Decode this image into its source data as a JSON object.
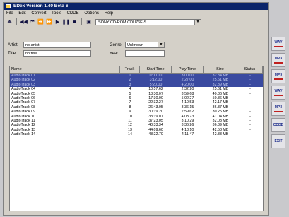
{
  "window": {
    "title": "EDex Version 1.40 Beta 6"
  },
  "menu": [
    "File",
    "Edit",
    "Convert",
    "Tools",
    "CDDB",
    "Options",
    "Help"
  ],
  "toolbar": {
    "drive": "SONY   CD-ROM CDU76E-S"
  },
  "fields": {
    "artist_label": "Artist",
    "artist_value": "no artist",
    "title_label": "Title",
    "title_value": "no title",
    "genre_label": "Genre",
    "genre_value": "Unknown",
    "year_label": "Year",
    "year_value": ""
  },
  "table": {
    "columns": [
      "Name",
      "Track",
      "Start Time",
      "Play Time",
      "Size",
      "Status"
    ],
    "rows": [
      [
        "AudioTrack 01",
        "1",
        "0:00.00",
        "3:00.00",
        "32.34 MB",
        "-"
      ],
      [
        "AudioTrack 02",
        "2",
        "3:12.00",
        "2:27.00",
        "25.61 MB",
        "-"
      ],
      [
        "AudioTrack 03",
        "3",
        "5:20.00",
        "4:20.00",
        "32.39 MB",
        "-"
      ],
      [
        "AudioTrack 04",
        "4",
        "10:57.62",
        "2:32.20",
        "25.61 MB",
        "-"
      ],
      [
        "AudioTrack 05",
        "5",
        "13:30.07",
        "3:59.68",
        "40.36 MB",
        "-"
      ],
      [
        "AudioTrack 06",
        "6",
        "17:30.00",
        "5:02.27",
        "50.86 MB",
        "-"
      ],
      [
        "AudioTrack 07",
        "7",
        "22:32.27",
        "4:10.53",
        "42.17 MB",
        "-"
      ],
      [
        "AudioTrack 08",
        "8",
        "26:43.05",
        "3:36.15",
        "36.37 MB",
        "-"
      ],
      [
        "AudioTrack 09",
        "9",
        "30:19.20",
        "2:59.62",
        "30.25 MB",
        "-"
      ],
      [
        "AudioTrack 10",
        "10",
        "33:19.07",
        "4:03.73",
        "41.04 MB",
        "-"
      ],
      [
        "AudioTrack 11",
        "11",
        "37:23.05",
        "3:10.29",
        "32.03 MB",
        "-"
      ],
      [
        "AudioTrack 12",
        "12",
        "40:33.34",
        "3:36.26",
        "36.39 MB",
        "-"
      ],
      [
        "AudioTrack 13",
        "13",
        "44:09.60",
        "4:13.10",
        "42.58 MB",
        "-"
      ],
      [
        "AudioTrack 14",
        "14",
        "48:22.70",
        "4:11.47",
        "42.33 MB",
        "-"
      ]
    ],
    "selected_rows": 3
  },
  "side_buttons": [
    "WAV",
    "MP3",
    "MP3",
    "WAV",
    "MP3",
    "CDDB",
    "EXIT"
  ]
}
